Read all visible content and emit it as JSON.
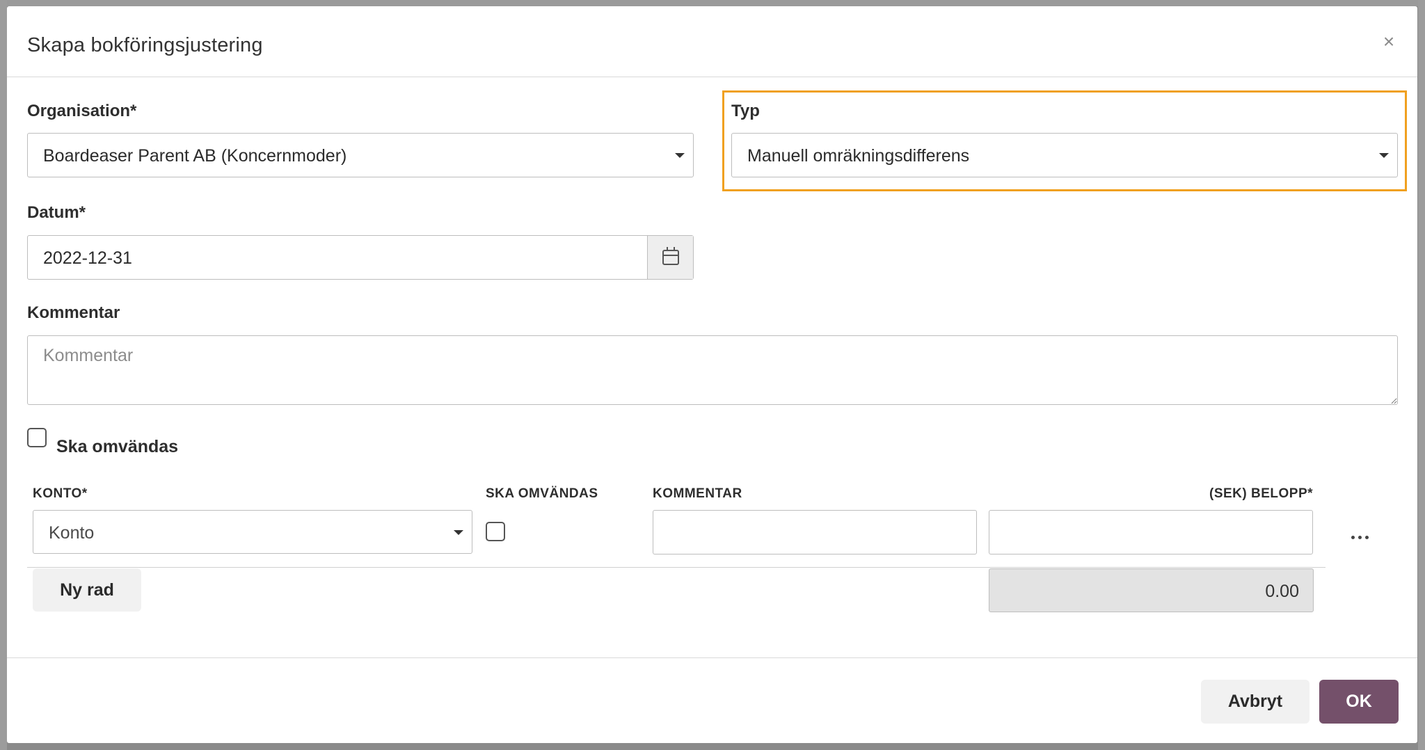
{
  "modal": {
    "title": "Skapa bokföringsjustering",
    "close": "×"
  },
  "form": {
    "organisation": {
      "label": "Organisation*",
      "value": "Boardeaser Parent AB (Koncernmoder)"
    },
    "typ": {
      "label": "Typ",
      "value": "Manuell omräkningsdifferens",
      "highlight_color": "#f0a020"
    },
    "datum": {
      "label": "Datum*",
      "value": "2022-12-31"
    },
    "kommentar": {
      "label": "Kommentar",
      "placeholder": "Kommentar"
    },
    "reverse": {
      "label": "Ska omvändas",
      "checked": false
    }
  },
  "table": {
    "headers": {
      "konto": "KONTO*",
      "reverse": "SKA OMVÄNDAS",
      "comment": "KOMMENTAR",
      "amount": "(SEK) BELOPP*"
    },
    "row": {
      "konto_placeholder": "Konto",
      "reverse_checked": false
    },
    "new_row_label": "Ny rad",
    "total": "0.00"
  },
  "footer": {
    "cancel_label": "Avbryt",
    "ok_label": "OK",
    "ok_color": "#74506a"
  }
}
